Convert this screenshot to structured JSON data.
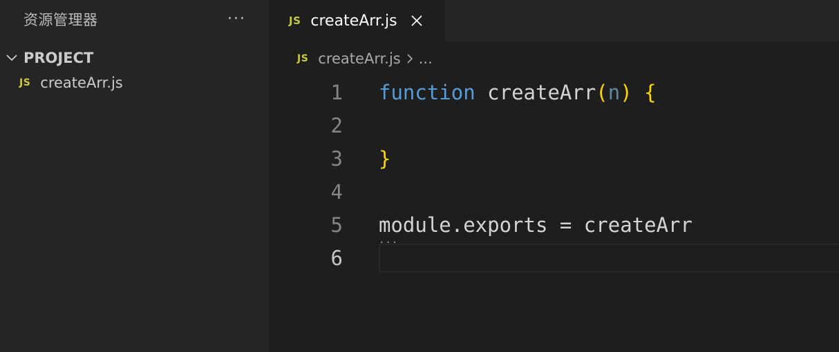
{
  "sidebar": {
    "title": "资源管理器",
    "more_label": "···",
    "section_title": "PROJECT",
    "files": [
      {
        "badge": "JS",
        "name": "createArr.js"
      }
    ]
  },
  "tabs": [
    {
      "badge": "JS",
      "label": "createArr.js"
    }
  ],
  "breadcrumb": {
    "badge": "JS",
    "file": "createArr.js",
    "more": "..."
  },
  "code": {
    "line_numbers": [
      "1",
      "2",
      "3",
      "4",
      "5",
      "6"
    ],
    "active_line": "6",
    "line1": {
      "keyword": "function",
      "name": "createArr",
      "open_paren": "(",
      "param": "n",
      "close_paren": ")",
      "brace": "{"
    },
    "line3": {
      "brace": "}"
    },
    "line5": {
      "text": "module.exports = createArr",
      "hint": "..."
    }
  },
  "colors": {
    "background": "#1e1e1e",
    "sidebar": "#252526",
    "js_badge": "#cbcb41",
    "keyword": "#569cd6",
    "bracket": "#ffd700"
  }
}
